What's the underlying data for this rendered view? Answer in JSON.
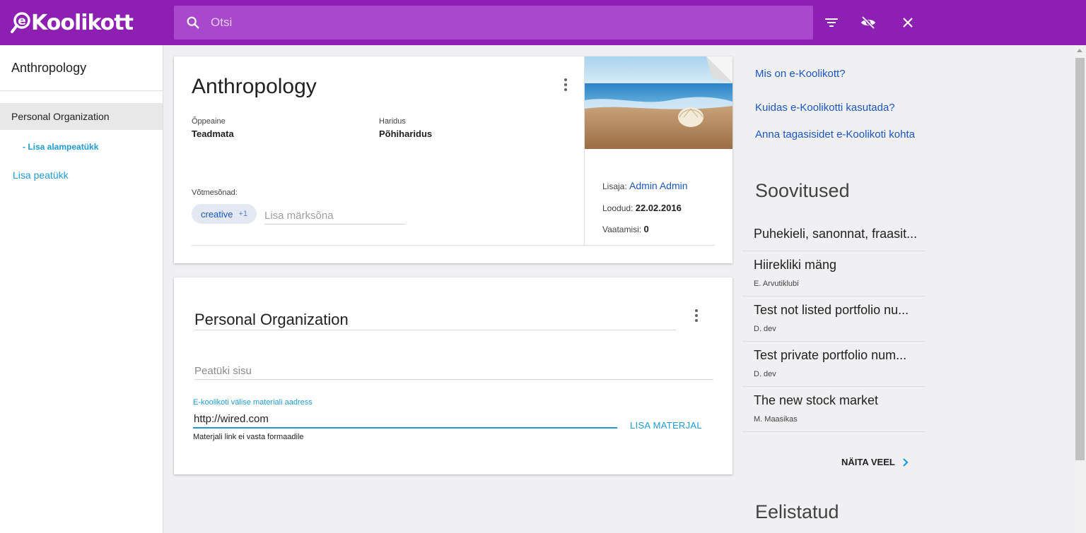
{
  "header": {
    "logo_text": "Koolikott",
    "logo_prefix": "e",
    "search_placeholder": "Otsi",
    "brand_color": "#8d1fb3",
    "icons": [
      "search-icon",
      "filter-icon",
      "visibility-off-icon",
      "close-icon"
    ]
  },
  "sidebar": {
    "title": "Anthropology",
    "chapter": "Personal Organization",
    "add_subchapter": "- Lisa alampeatükk",
    "add_chapter": "Lisa peatükk"
  },
  "portfolio": {
    "title": "Anthropology",
    "subject_label": "Õppeaine",
    "subject_value": "Teadmata",
    "education_label": "Haridus",
    "education_value": "Põhiharidus",
    "keywords_label": "Võtmesõnad:",
    "keyword_chip": "creative",
    "keyword_more": "+1",
    "keyword_placeholder": "Lisa märksõna",
    "creator_label": "Lisaja:",
    "creator_value": "Admin Admin",
    "added_label": "Loodud:",
    "added_value": "22.02.2016",
    "views_label": "Vaatamisi:",
    "views_value": "0"
  },
  "chapter": {
    "title": "Personal Organization",
    "content_placeholder": "Peatüki sisu",
    "url_label": "E-koolikoti välise materiali aadress",
    "url_value": "http://wired.com",
    "url_hint": "Materjali link ei vasta formaadile",
    "add_button": "LISA MATERJAL"
  },
  "right": {
    "links": [
      "Mis on e-Koolikott?",
      "Kuidas e-Koolikotti kasutada?",
      "Anna tagasisidet e-Koolikoti kohta"
    ],
    "recommendations_title": "Soovitused",
    "recommendations": [
      {
        "title": "Puhekieli, sanonnat, fraasit...",
        "author": ""
      },
      {
        "title": "Hiirekliki mäng",
        "author": "E. Arvutiklubi"
      },
      {
        "title": "Test not listed portfolio nu...",
        "author": "D. dev"
      },
      {
        "title": "Test private portfolio num...",
        "author": "D. dev"
      },
      {
        "title": "The new stock market",
        "author": "M. Maasikas"
      }
    ],
    "show_more": "NÄITA VEEL",
    "favorites_title": "Eelistatud"
  }
}
